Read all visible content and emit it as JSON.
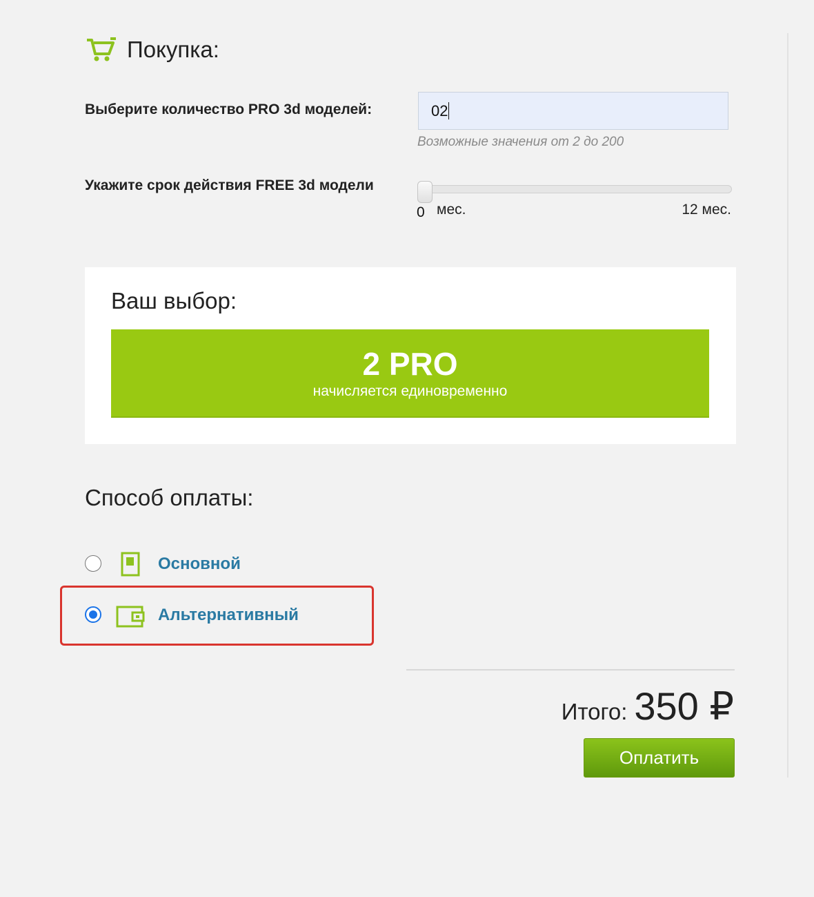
{
  "header": {
    "title": "Покупка:",
    "icon": "cart-icon"
  },
  "quantity": {
    "label": "Выберите количество PRO 3d моделей:",
    "value": "02",
    "hint": "Возможные значения от 2 до 200"
  },
  "period": {
    "label": "Укажите срок действия FREE 3d модели",
    "min_value": "0",
    "min_unit": "мес.",
    "max_label": "12 мес.",
    "current_months": 0
  },
  "choice": {
    "title": "Ваш выбор:",
    "amount": "2 PRO",
    "note": "начисляется единовременно"
  },
  "payment": {
    "title": "Способ оплаты:",
    "methods": [
      {
        "label": "Основной",
        "icon": "card-icon",
        "selected": false
      },
      {
        "label": "Альтернативный",
        "icon": "wallet-icon",
        "selected": true
      }
    ]
  },
  "total": {
    "label": "Итого:",
    "value": "350 ₽"
  },
  "pay_button": "Оплатить",
  "colors": {
    "accent_green": "#99c912",
    "link_blue": "#2a7aa3",
    "highlight_red": "#d9352e",
    "radio_blue": "#1a73e8"
  }
}
